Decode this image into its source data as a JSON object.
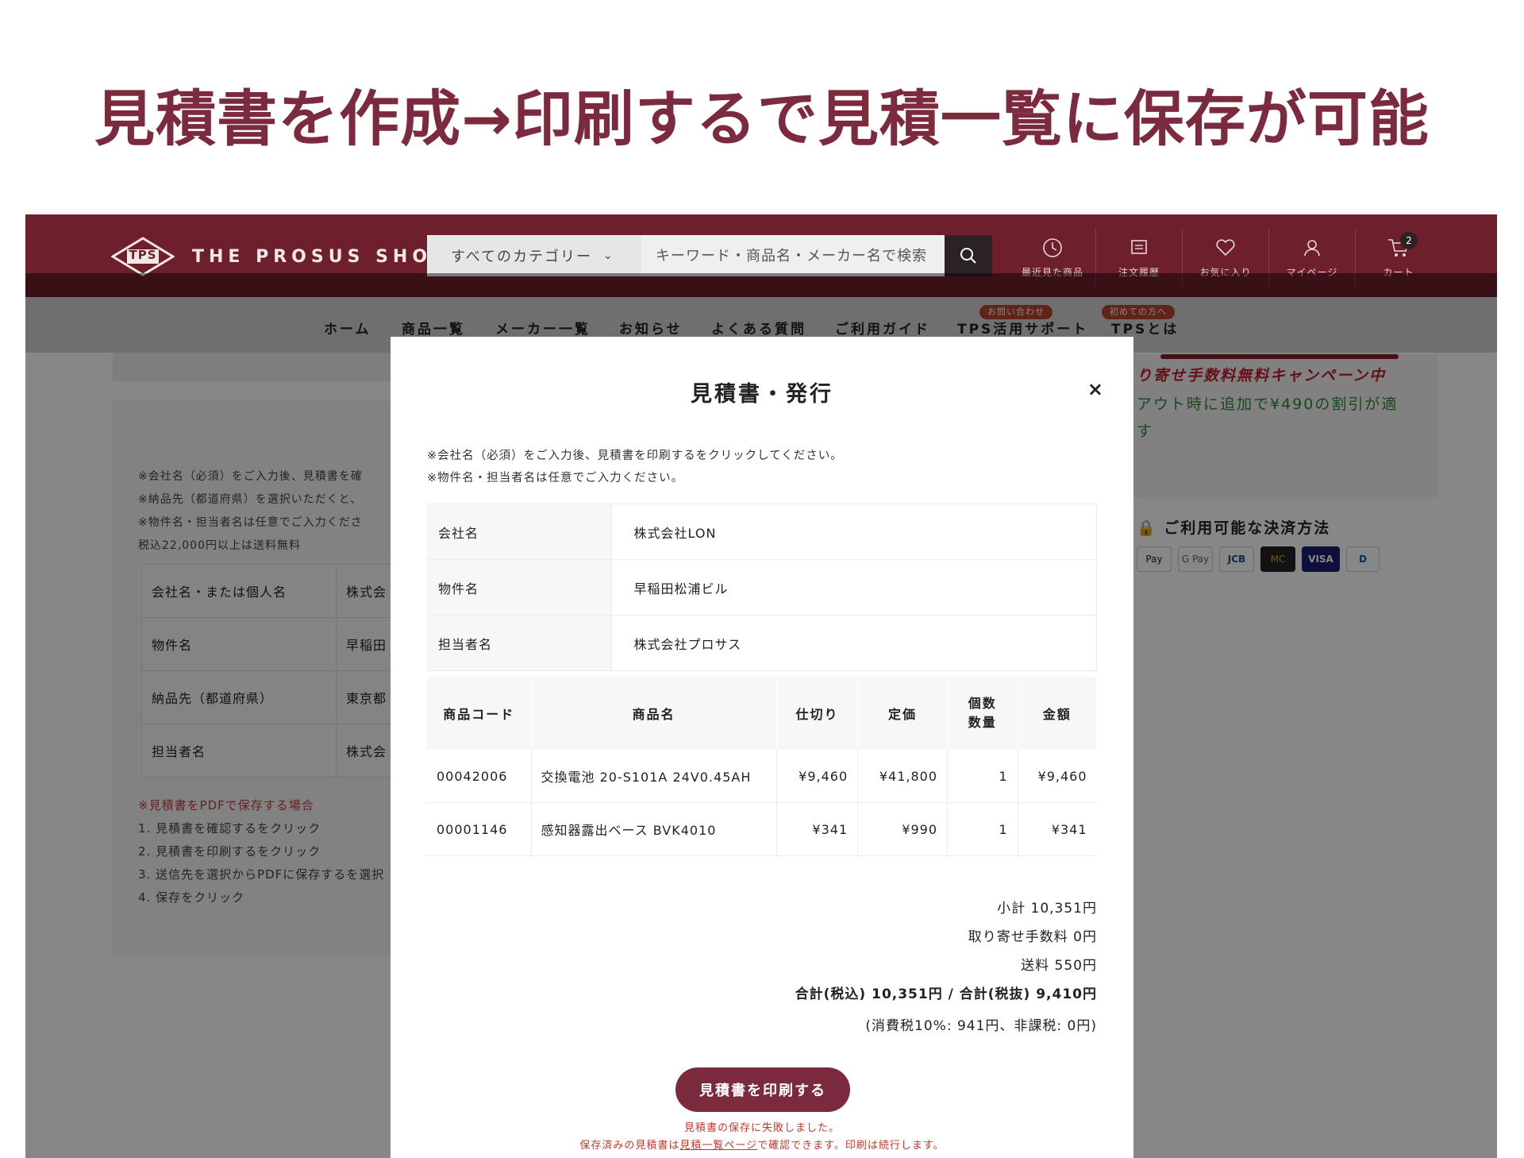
{
  "headline": "見積書を作成→印刷するで見積一覧に保存が可能",
  "header": {
    "logo_mark": "TPS",
    "logo_text": "THE PROSUS SHOP",
    "category_label": "すべてのカテゴリー",
    "search_placeholder": "キーワード・商品名・メーカー名で検索",
    "icons": [
      {
        "label": "最近見た商品",
        "icon": "history-icon"
      },
      {
        "label": "注文履歴",
        "icon": "receipt-icon"
      },
      {
        "label": "お気に入り",
        "icon": "heart-icon"
      },
      {
        "label": "マイページ",
        "icon": "user-icon"
      },
      {
        "label": "カート",
        "icon": "cart-icon",
        "badge": "2"
      }
    ]
  },
  "nav": {
    "items": [
      "ホーム",
      "商品一覧",
      "メーカー一覧",
      "お知らせ",
      "よくある質問",
      "ご利用ガイド",
      "TPS活用サポート",
      "TPSとは"
    ],
    "tag_support": "お問い合わせ",
    "tag_about": "初めての方へ"
  },
  "background_page": {
    "notes": [
      "※会社名（必須）をご入力後、見積書を確",
      "※納品先（都道府県）を選択いただくと、",
      "※物件名・担当者名は任意でご入力くださ",
      "税込22,000円以上は送料無料"
    ],
    "rows": [
      {
        "k": "会社名・または個人名",
        "v": "株式会"
      },
      {
        "k": "物件名",
        "v": "早稲田"
      },
      {
        "k": "納品先（都道府県）",
        "v": "東京都"
      },
      {
        "k": "担当者名",
        "v": "株式会"
      }
    ],
    "pdf_title": "※見積書をPDFで保存する場合",
    "pdf_steps": [
      "1. 見積書を確認するをクリック",
      "2. 見積書を印刷するをクリック",
      "3. 送信先を選択からPDFに保存するを選択",
      "4. 保存をクリック"
    ],
    "campaign_red": "り寄せ手数料無料キャンペーン中",
    "campaign_green": "アウト時に追加で¥490の割引が適",
    "campaign_green2": "す",
    "payment_title": "ご利用可能な決済方法",
    "payment_methods": [
      "Pay",
      "G Pay",
      "JCB",
      "MC",
      "VISA",
      "D"
    ]
  },
  "modal": {
    "title": "見積書・発行",
    "close": "×",
    "notes": [
      "※会社名（必須）をご入力後、見積書を印刷するをクリックしてください。",
      "※物件名・担当者名は任意でご入力ください。"
    ],
    "info": [
      {
        "k": "会社名",
        "v": "株式会社LON"
      },
      {
        "k": "物件名",
        "v": "早稲田松浦ビル"
      },
      {
        "k": "担当者名",
        "v": "株式会社プロサス"
      }
    ],
    "columns": [
      "商品コード",
      "商品名",
      "仕切り",
      "定価",
      "個数 数量",
      "金額"
    ],
    "items": [
      {
        "code": "00042006",
        "name": "交換電池 20-S101A 24V0.45AH",
        "shikiri": "¥9,460",
        "price": "¥41,800",
        "qty": "1",
        "amount": "¥9,460"
      },
      {
        "code": "00001146",
        "name": "感知器露出ベース BVK4010",
        "shikiri": "¥341",
        "price": "¥990",
        "qty": "1",
        "amount": "¥341"
      }
    ],
    "subtotal": "小計 10,351円",
    "order_fee": "取り寄せ手数料 0円",
    "shipping": "送料 550円",
    "total": "合計(税込) 10,351円 / 合計(税抜) 9,410円",
    "tax": "(消費税10%: 941円、非課税: 0円)",
    "print_button": "見積書を印刷する",
    "error_line1": "見積書の保存に失敗しました。",
    "error_pre": "保存済みの見積書は",
    "error_link": "見積一覧ページ",
    "error_post": "で確認できます。印刷は続行します。"
  },
  "colors": {
    "brand": "#6e1f2c",
    "accent": "#7c2b3f",
    "error": "#c0392b"
  }
}
